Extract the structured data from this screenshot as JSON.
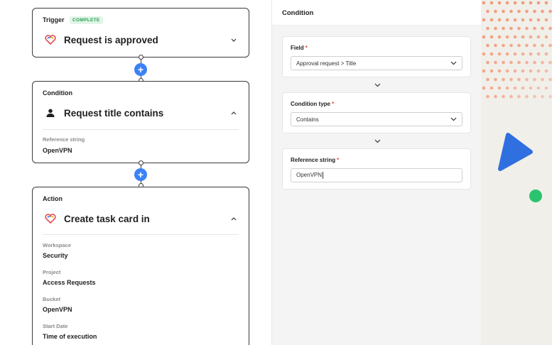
{
  "workflow": {
    "trigger": {
      "kind": "Trigger",
      "badge": "COMPLETE",
      "title": "Request is approved",
      "icon": "heart-logo-icon"
    },
    "condition": {
      "kind": "Condition",
      "title": "Request title contains",
      "icon": "person-icon",
      "fields": [
        {
          "label": "Reference string",
          "value": "OpenVPN"
        }
      ]
    },
    "action": {
      "kind": "Action",
      "title": "Create task card in",
      "icon": "heart-logo-icon",
      "fields": [
        {
          "label": "Workspace",
          "value": "Security"
        },
        {
          "label": "Project",
          "value": "Access Requests"
        },
        {
          "label": "Bucket",
          "value": "OpenVPN"
        },
        {
          "label": "Start Date",
          "value": "Time of execution"
        }
      ]
    }
  },
  "panel": {
    "title": "Condition",
    "fields": [
      {
        "label": "Field",
        "value": "Approval request > Title",
        "type": "select"
      },
      {
        "label": "Condition type",
        "value": "Contains",
        "type": "select"
      },
      {
        "label": "Reference string",
        "value": "OpenVPN",
        "type": "text"
      }
    ]
  },
  "colors": {
    "accent": "#3b82f6",
    "complete_badge_text": "#2e9e57",
    "complete_badge_bg": "#e1f5e7",
    "required_asterisk": "#e5484d",
    "deco_dots": "#f29a7c",
    "deco_triangle": "#2f6fe0",
    "deco_circle": "#2bc46e"
  }
}
